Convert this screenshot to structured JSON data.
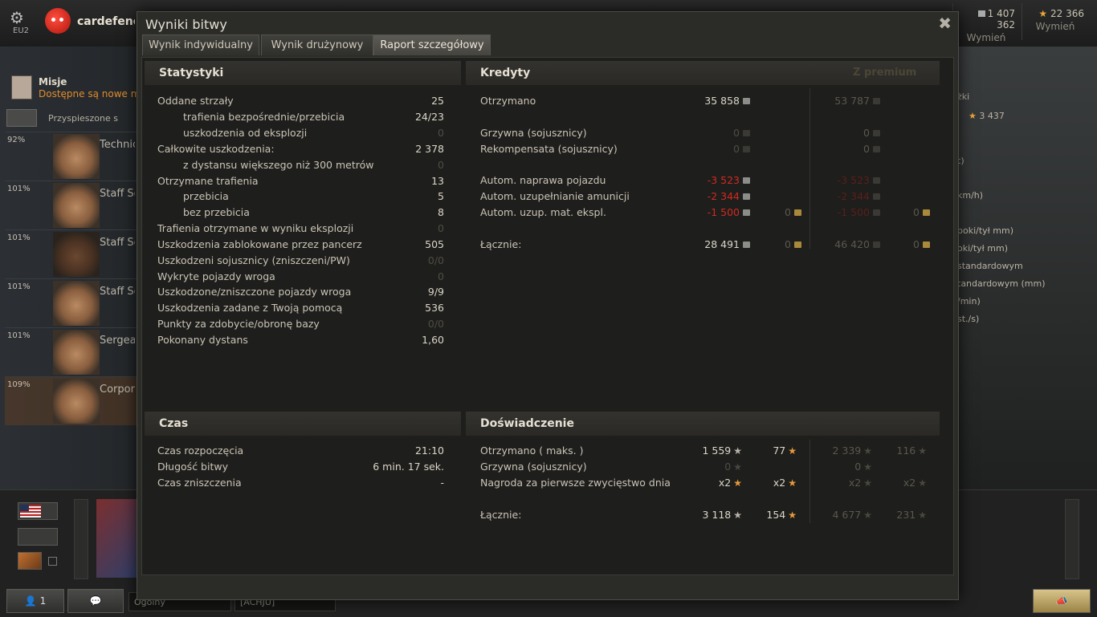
{
  "topbar": {
    "server": "EU2",
    "username": "cardefence[A",
    "credits": "1 407 362",
    "credits_action": "Wymień",
    "gold": "22 366",
    "gold_action": "Wymień"
  },
  "left_panel": {
    "missions_title": "Misje",
    "missions_sub": "Dostępne są nowe misje",
    "accelerated": "Przyspieszone s",
    "crew": [
      {
        "pct": "92%",
        "role": "Technical"
      },
      {
        "pct": "101%",
        "role": "Staff Sergeant"
      },
      {
        "pct": "101%",
        "role": "Staff Sergeant"
      },
      {
        "pct": "101%",
        "role": "Staff Sergeant"
      },
      {
        "pct": "101%",
        "role": "Sergeant"
      },
      {
        "pct": "109%",
        "role": "Corporal"
      }
    ]
  },
  "right_panel": {
    "items": [
      "żki",
      "3 437",
      "t)",
      "km/h)",
      "boki/tył mm)",
      "oki/tył mm)",
      "standardowym",
      "tandardowym (mm)",
      "/min)",
      "st./s)"
    ]
  },
  "bottom": {
    "players_btn": "1",
    "channel_general": "Ogólny",
    "channel_clan": "[ACHJU]"
  },
  "modal": {
    "title": "Wyniki bitwy",
    "tabs": [
      "Wynik indywidualny",
      "Wynik drużynowy",
      "Raport szczegółowy"
    ],
    "active_tab": 2,
    "stats": {
      "title": "Statystyki",
      "rows": [
        {
          "label": "Oddane strzały",
          "value": "25"
        },
        {
          "label": "trafienia bezpośrednie/przebicia",
          "value": "24/23"
        },
        {
          "label": "uszkodzenia od eksplozji",
          "value": "0"
        },
        {
          "label": "Całkowite uszkodzenia:",
          "value": "2 378"
        },
        {
          "label": "z dystansu większego niż 300 metrów",
          "value": "0"
        },
        {
          "label": "Otrzymane trafienia",
          "value": "13"
        },
        {
          "label": "przebicia",
          "value": "5"
        },
        {
          "label": "bez przebicia",
          "value": "8"
        },
        {
          "label": "Trafienia otrzymane w wyniku eksplozji",
          "value": "0"
        },
        {
          "label": "Uszkodzenia zablokowane przez pancerz",
          "value": "505"
        },
        {
          "label": "Uszkodzeni sojusznicy (zniszczeni/PW)",
          "value": "0/0"
        },
        {
          "label": "Wykryte pojazdy wroga",
          "value": "0"
        },
        {
          "label": "Uszkodzone/zniszczone pojazdy wroga",
          "value": "9/9"
        },
        {
          "label": "Uszkodzenia zadane z Twoją pomocą",
          "value": "536"
        },
        {
          "label": "Punkty za zdobycie/obronę bazy",
          "value": "0/0"
        },
        {
          "label": "Pokonany dystans",
          "value": "1,60"
        }
      ]
    },
    "credits": {
      "title": "Kredyty",
      "premium_title": "Z premium",
      "received_label": "Otrzymano",
      "received": "35 858",
      "received_premium": "53 787",
      "fine_label": "Grzywna (sojusznicy)",
      "fine": "0",
      "fine_premium": "0",
      "comp_label": "Rekompensata (sojusznicy)",
      "comp": "0",
      "comp_premium": "0",
      "repair_label": "Autom. naprawa pojazdu",
      "repair": "-3 523",
      "repair_premium": "-3 523",
      "ammo_label": "Autom. uzupełnianie amunicji",
      "ammo": "-2 344",
      "ammo_premium": "-2 344",
      "equip_label": "Autom. uzup. mat. ekspl.",
      "equip": "-1 500",
      "equip_gold": "0",
      "equip_premium": "-1 500",
      "equip_premium_gold": "0",
      "total_label": "Łącznie:",
      "total": "28 491",
      "total_gold": "0",
      "total_premium": "46 420",
      "total_premium_gold": "0"
    },
    "time": {
      "title": "Czas",
      "start_label": "Czas rozpoczęcia",
      "start": "21:10",
      "duration_label": "Długość bitwy",
      "duration": "6 min. 17 sek.",
      "destroyed_label": "Czas zniszczenia",
      "destroyed": "-"
    },
    "experience": {
      "title": "Doświadczenie",
      "received_label": "Otrzymano ( maks. )",
      "received": "1 559",
      "received_free": "77",
      "received_premium": "2 339",
      "received_premium_free": "116",
      "fine_label": "Grzywna (sojusznicy)",
      "fine": "0",
      "fine_premium": "0",
      "bonus_label": "Nagroda za pierwsze zwycięstwo dnia",
      "bonus": "x2",
      "bonus_free": "x2",
      "bonus_premium": "x2",
      "bonus_premium_free": "x2",
      "total_label": "Łącznie:",
      "total": "3 118",
      "total_free": "154",
      "total_premium": "4 677",
      "total_premium_free": "231"
    }
  }
}
